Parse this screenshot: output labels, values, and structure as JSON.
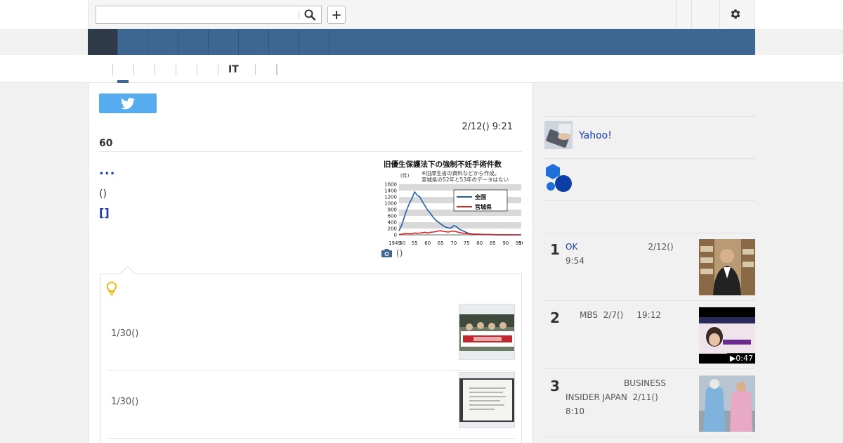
{
  "search": {
    "placeholder": "",
    "value": ""
  },
  "header": {
    "add_label": "+"
  },
  "subnav": {
    "items": [
      "",
      "",
      "",
      "",
      "",
      "IT",
      "",
      ""
    ]
  },
  "article": {
    "date": "2/12() 9:21",
    "title": "60",
    "more_link": "...",
    "paren_text": "()",
    "bracket_link": "[]",
    "photo_caption": "()"
  },
  "chart_data": {
    "type": "line",
    "title": "旧優生保護法下の強制不妊手術件数",
    "annotation": [
      "※旧厚生省の資料などから作成。",
      "宮城県の52年と53年のデータはない"
    ],
    "ylabel": "(件)",
    "ylim": [
      0,
      1600
    ],
    "yticks": [
      0,
      200,
      400,
      600,
      800,
      1000,
      1200,
      1400,
      1600
    ],
    "xticks": [
      "1949",
      "50",
      "55",
      "60",
      "65",
      "70",
      "75",
      "80",
      "85",
      "90",
      "95",
      "96年"
    ],
    "legend_position": "right",
    "grid": true,
    "series": [
      {
        "name": "全国",
        "color": "#1f5fa8",
        "x": [
          1949,
          1950,
          1951,
          1952,
          1953,
          1954,
          1955,
          1956,
          1957,
          1958,
          1959,
          1960,
          1961,
          1962,
          1963,
          1964,
          1965,
          1966,
          1967,
          1968,
          1969,
          1970,
          1971,
          1972,
          1973,
          1974,
          1975,
          1976,
          1977,
          1978,
          1979,
          1980,
          1981,
          1982,
          1983,
          1984,
          1985,
          1986,
          1987,
          1988,
          1989,
          1990,
          1991,
          1992,
          1993,
          1994,
          1995,
          1996
        ],
        "values": [
          130,
          300,
          550,
          800,
          1000,
          1150,
          1360,
          1250,
          1200,
          1050,
          920,
          780,
          690,
          570,
          470,
          410,
          350,
          290,
          240,
          220,
          210,
          290,
          270,
          190,
          150,
          110,
          70,
          40,
          30,
          20,
          25,
          20,
          15,
          15,
          10,
          10,
          8,
          5,
          3,
          3,
          2,
          2,
          1,
          1,
          1,
          1,
          0,
          0
        ]
      },
      {
        "name": "宮城県",
        "color": "#d0282b",
        "x": [
          1949,
          1950,
          1951,
          1954,
          1955,
          1956,
          1957,
          1958,
          1959,
          1960,
          1961,
          1962,
          1963,
          1964,
          1965,
          1966,
          1967,
          1968,
          1969,
          1970,
          1971,
          1972,
          1973,
          1974,
          1975,
          1976,
          1977,
          1978,
          1979,
          1980,
          1981,
          1985,
          1990,
          1995,
          1996
        ],
        "values": [
          10,
          20,
          40,
          35,
          60,
          50,
          55,
          70,
          80,
          60,
          80,
          90,
          100,
          120,
          130,
          110,
          100,
          90,
          110,
          120,
          100,
          80,
          60,
          50,
          40,
          35,
          30,
          20,
          15,
          10,
          10,
          5,
          2,
          0,
          0
        ]
      }
    ]
  },
  "related": {
    "items": [
      {
        "date": "1/30()"
      },
      {
        "date": "1/30()"
      }
    ]
  },
  "sidebar": {
    "yahoo_link": "Yahoo!",
    "ranking": [
      {
        "rank": "1",
        "source": "OK",
        "date": "2/12()",
        "time": "9:54"
      },
      {
        "rank": "2",
        "source": "MBS",
        "date": "2/7()",
        "time": "19:12",
        "duration": "▶0:47"
      },
      {
        "rank": "3",
        "source": "BUSINESS INSIDER JAPAN",
        "date": "2/11()",
        "time": "8:10"
      }
    ]
  },
  "colors": {
    "nav": "#3d6691",
    "nav_active": "#2f3a48",
    "link": "#1a3ea4",
    "twitter": "#55acee"
  }
}
